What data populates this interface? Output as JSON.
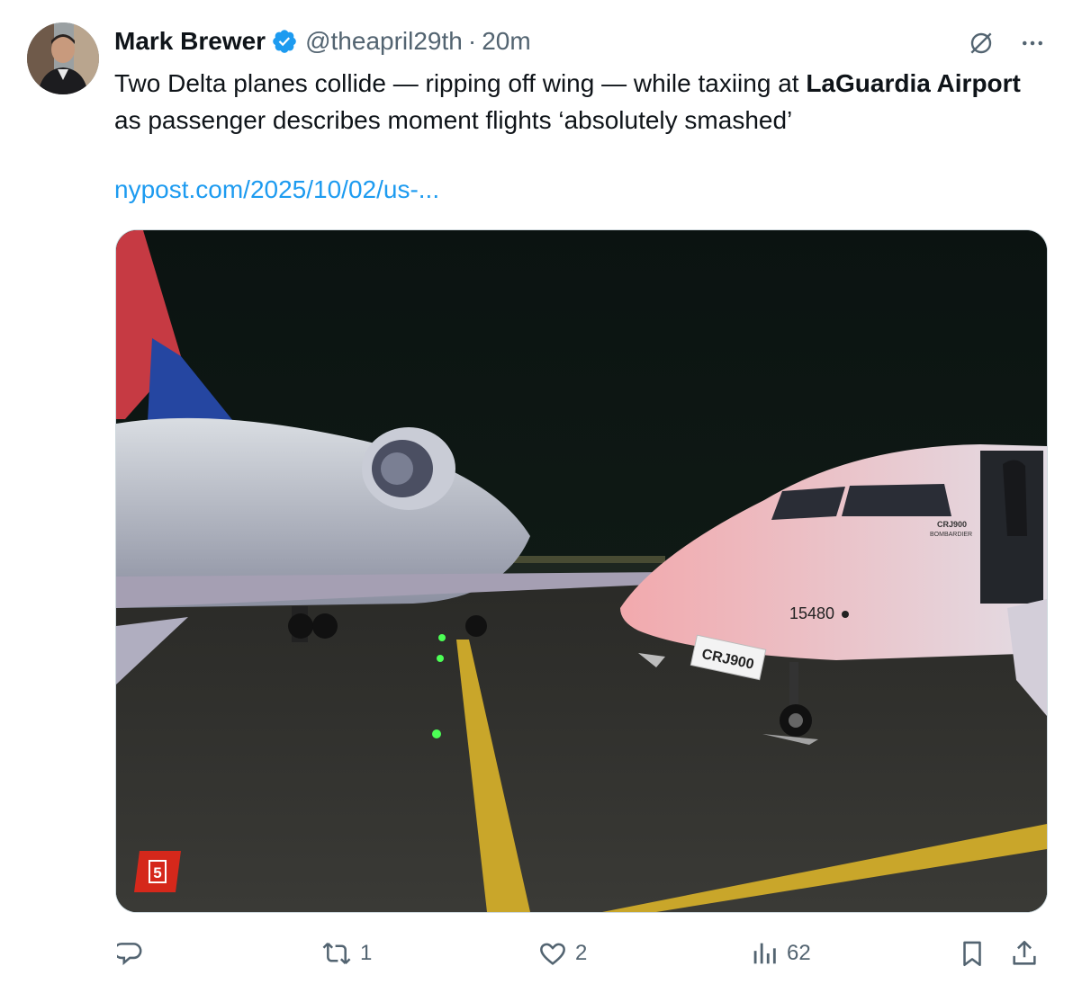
{
  "author": {
    "display_name": "Mark Brewer",
    "handle": "@theapril29th",
    "separator": "·",
    "timestamp": "20m",
    "verified": true
  },
  "tweet": {
    "text_part1": "Two Delta planes collide — ripping off wing — while taxiing at ",
    "text_bold": "LaGuardia Airport",
    "text_part2": " as passenger describes moment flights ‘absolutely smashed’",
    "link": "nypost.com/2025/10/02/us-..."
  },
  "media": {
    "description_icons": [
      "tail-fin",
      "regional-jet",
      "taxiway-line"
    ],
    "nose_label": "CRJ900",
    "tail_number": "15480",
    "side_label": "CRJ900",
    "side_sublabel": "BOMBARDIER",
    "badge": "5"
  },
  "actions": {
    "reply_count": "",
    "retweet_count": "1",
    "like_count": "2",
    "views_count": "62"
  },
  "colors": {
    "link": "#1d9bf0",
    "muted": "#536471",
    "verified": "#1d9bf0",
    "badge": "#d5281b"
  }
}
